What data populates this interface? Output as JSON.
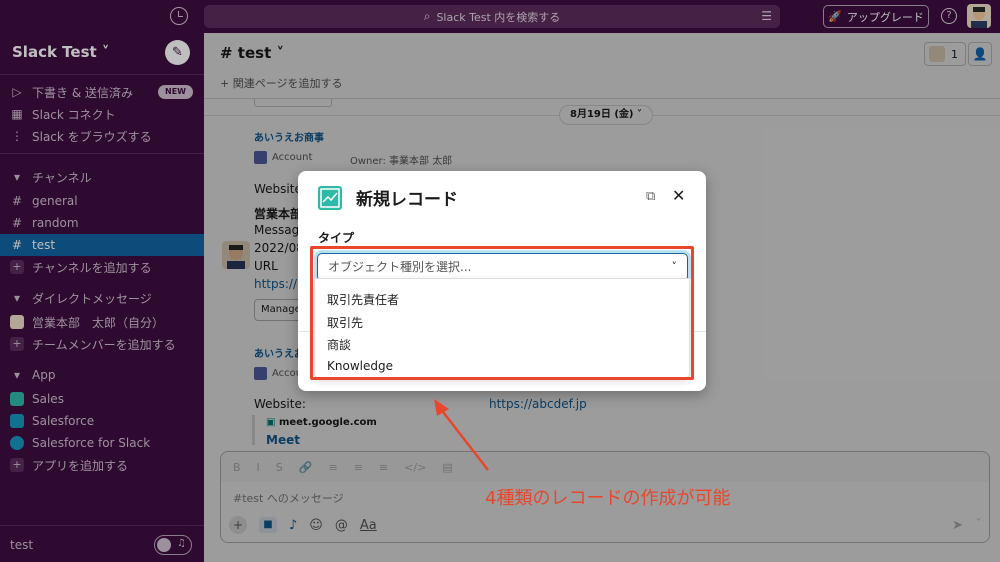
{
  "topbar": {
    "search_placeholder": "Slack Test 内を検索する",
    "upgrade_label": "アップグレード",
    "help_label": "?"
  },
  "sidebar": {
    "workspace": "Slack Test",
    "nav": [
      {
        "label": "下書き & 送信済み",
        "badge": "NEW"
      },
      {
        "label": "Slack コネクト"
      },
      {
        "label": "Slack をブラウズする"
      }
    ],
    "channels_header": "チャンネル",
    "channels": [
      "general",
      "random",
      "test"
    ],
    "add_channel": "チャンネルを追加する",
    "dm_header": "ダイレクトメッセージ",
    "dm_self": "営業本部　太郎（自分）",
    "add_member": "チームメンバーを追加する",
    "apps_header": "App",
    "apps": [
      "Sales",
      "Salesforce",
      "Salesforce for Slack"
    ],
    "add_app": "アプリを追加する",
    "footer": "test"
  },
  "channel": {
    "title": "# test",
    "member_count": "1",
    "bookmark": "+ 関連ページを追加する",
    "date": "8月19日 (金)"
  },
  "messages": {
    "deal1": "あいうえお商事",
    "account_label": "Account",
    "owner": "Owner: 事業本部 太郎",
    "website_label": "Website",
    "sender": "営業本部",
    "line_message": "Message",
    "line_date": "2022/08",
    "line_url": "URL",
    "line_link": "https://m",
    "manage_btn": "Manage",
    "deal2": "あいうえお",
    "account2": "Accou",
    "website2": "Website:",
    "website2_url": "https://abcdef.jp",
    "meet_domain": "meet.google.com",
    "meet_link": "Meet"
  },
  "composer": {
    "placeholder": "#test へのメッセージ",
    "format_icons": [
      "B",
      "I",
      "S",
      "🔗",
      "≡",
      "≡",
      "≡",
      "</>",
      "▤"
    ],
    "tools_aa": "Aa"
  },
  "modal": {
    "title": "新規レコード",
    "field_label": "タイプ",
    "select_placeholder": "オブジェクト種別を選択...",
    "options": [
      "取引先責任者",
      "取引先",
      "商談",
      "Knowledge"
    ]
  },
  "annotation": {
    "text": "4種類のレコードの作成が可能",
    "color": "#e8472d"
  }
}
